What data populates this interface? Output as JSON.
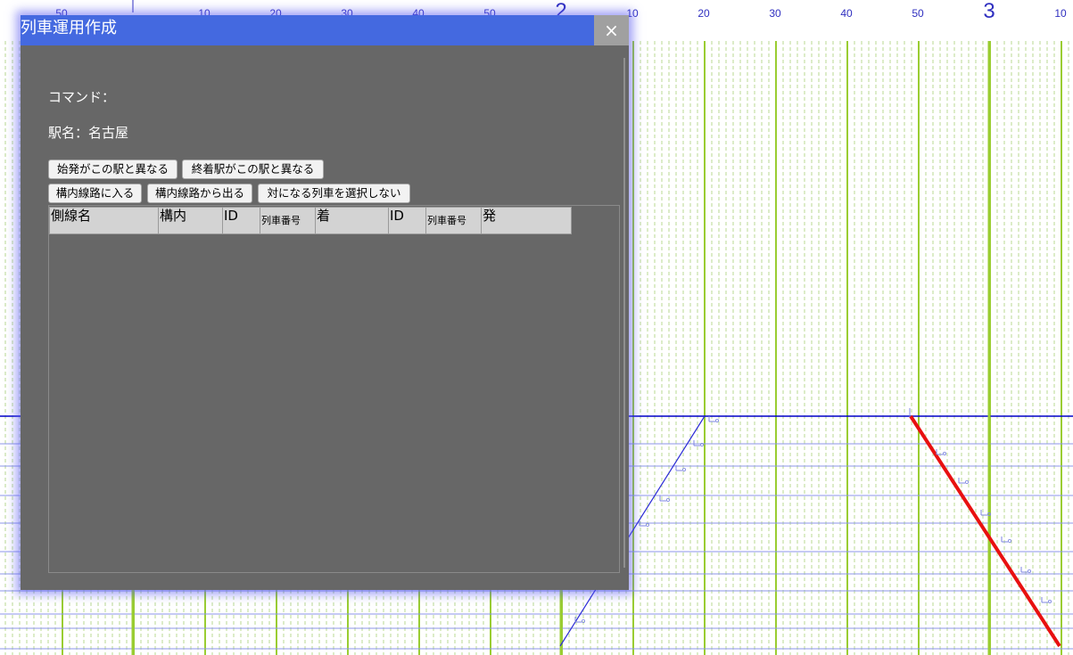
{
  "ruler": {
    "hour_labels": [
      "2",
      "3"
    ],
    "minute_labels": [
      "50",
      "10",
      "20",
      "30",
      "40",
      "50",
      "10",
      "20",
      "30",
      "40",
      "50",
      "10"
    ]
  },
  "colors": {
    "hour_line": "#9acd32",
    "minor_line": "#b8d890",
    "station_line_main": "#0000c8",
    "station_line": "#8c96e8",
    "train_blue": "#2b2bd6",
    "train_selected": "#e81010",
    "dialog_title_bg": "#4469e0",
    "dialog_bg": "#676767"
  },
  "dialog": {
    "title": "列車運用作成",
    "close_icon": "×",
    "command_label": "コマンド：",
    "station_label": "駅名：名古屋",
    "buttons": [
      "始発がこの駅と異なる",
      "終着駅がこの駅と異なる",
      "構内線路に入る",
      "構内線路から出る",
      "対になる列車を選択しない"
    ],
    "table_headers": [
      "側線名",
      "構内",
      "ID",
      "列車番号",
      "着",
      "ID",
      "列車番号",
      "発"
    ]
  }
}
